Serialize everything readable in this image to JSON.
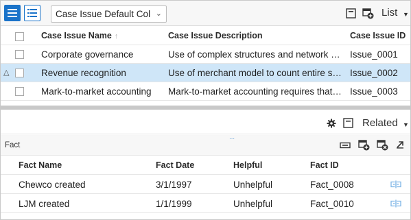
{
  "toolbar": {
    "view_buttons": [
      {
        "icon": "grid-view-icon",
        "active": true
      },
      {
        "icon": "list-detail-view-icon",
        "active": false
      }
    ],
    "column_set": "Case Issue Default Col",
    "icons": [
      "collapse-panel-icon",
      "add-record-icon"
    ],
    "view_label": "List"
  },
  "case_issues": {
    "columns": [
      "Case Issue Name",
      "Case Issue Description",
      "Case Issue ID"
    ],
    "rows": [
      {
        "name": "Corporate governance",
        "description": "Use of complex structures and network of subsidiaries",
        "id": "Issue_0001",
        "selected": false
      },
      {
        "name": "Revenue recognition",
        "description": "Use of merchant model to count entire sale as revenue",
        "id": "Issue_0002",
        "selected": true
      },
      {
        "name": "Mark-to-market accounting",
        "description": "Mark-to-market accounting requires that assets be valued",
        "id": "Issue_0003",
        "selected": false
      }
    ]
  },
  "related": {
    "label": "Related",
    "icons": [
      "settings-icon",
      "collapse-panel-icon"
    ],
    "section_title": "Fact",
    "section_icons": [
      "link-record-icon",
      "add-record-icon",
      "remove-record-icon",
      "open-external-icon"
    ],
    "columns": [
      "Fact Name",
      "Fact Date",
      "Helpful",
      "Fact ID"
    ],
    "rows": [
      {
        "name": "Chewco created",
        "date": "3/1/1997",
        "helpful": "Unhelpful",
        "id": "Fact_0008"
      },
      {
        "name": "LJM created",
        "date": "1/1/1999",
        "helpful": "Unhelpful",
        "id": "Fact_0010"
      }
    ]
  },
  "colors": {
    "accent": "#1a73c9",
    "selected_row": "#cfe6f8",
    "link_icon": "#7fb6e6"
  }
}
